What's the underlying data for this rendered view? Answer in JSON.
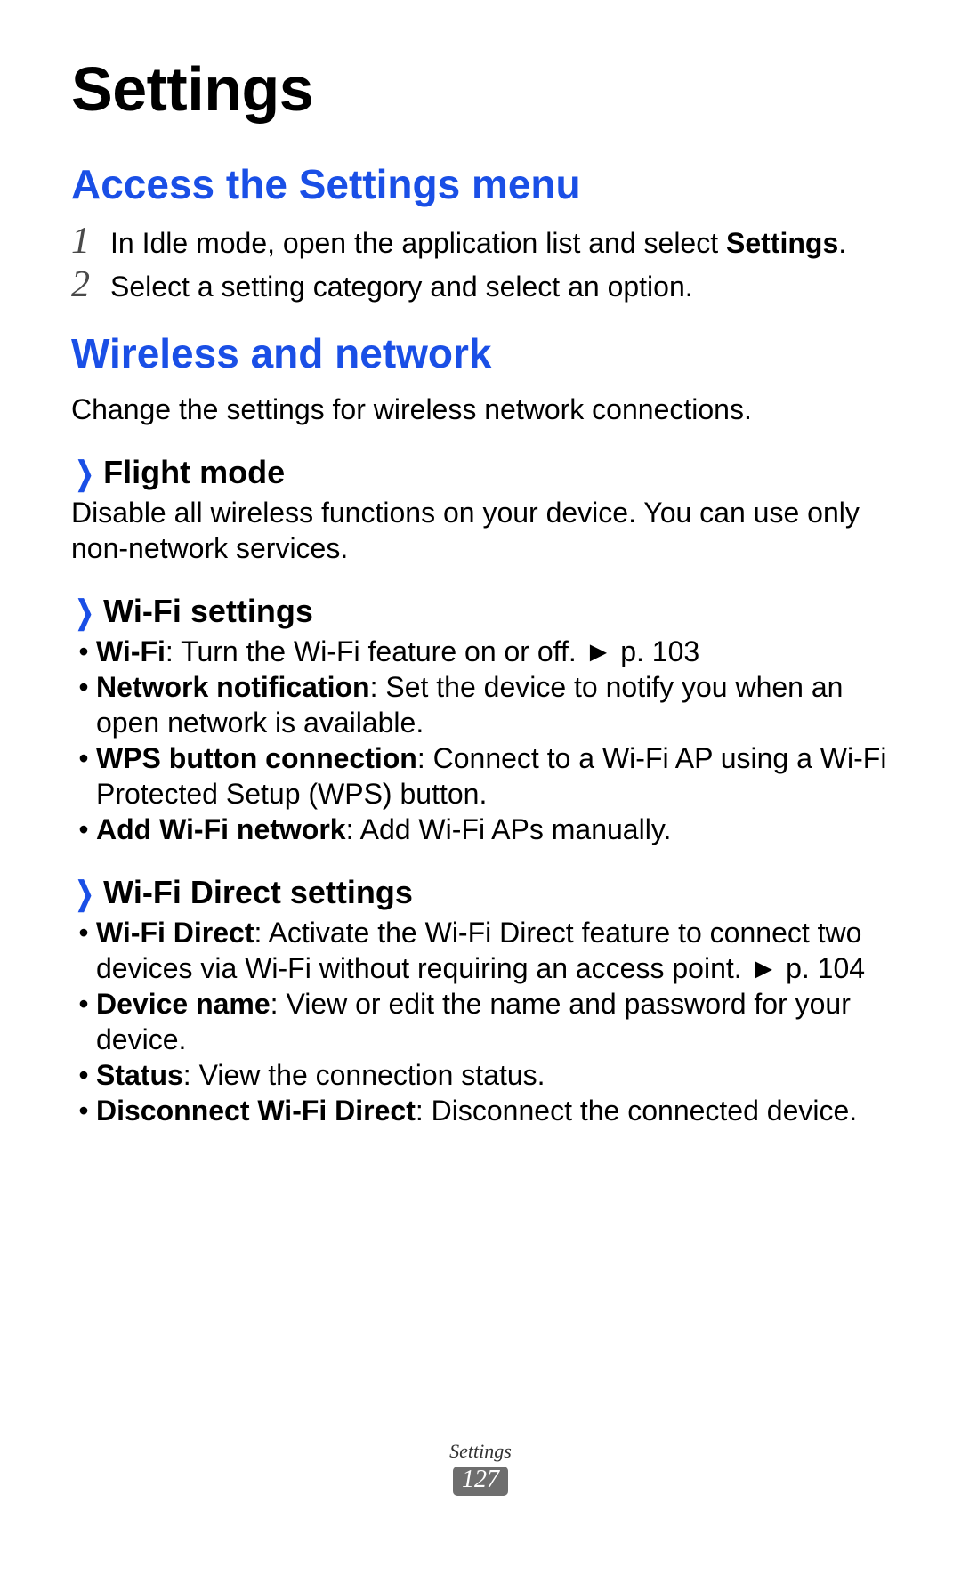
{
  "title": "Settings",
  "sections": {
    "access": {
      "heading": "Access the Settings menu",
      "steps": [
        {
          "num": "1",
          "pre": "In Idle mode, open the application list and select ",
          "bold": "Settings",
          "post": "."
        },
        {
          "num": "2",
          "pre": "Select a setting category and select an option.",
          "bold": "",
          "post": ""
        }
      ]
    },
    "wireless": {
      "heading": "Wireless and network",
      "desc": "Change the settings for wireless network connections.",
      "subs": [
        {
          "title": "Flight mode",
          "desc": "Disable all wireless functions on your device. You can use only non-network services.",
          "bullets": []
        },
        {
          "title": "Wi-Fi settings",
          "desc": "",
          "bullets": [
            {
              "bold": "Wi-Fi",
              "rest": ": Turn the Wi-Fi feature on or off. ► p. 103"
            },
            {
              "bold": "Network notification",
              "rest": ": Set the device to notify you when an open network is available."
            },
            {
              "bold": "WPS button connection",
              "rest": ": Connect to a Wi-Fi AP using a Wi-Fi Protected Setup (WPS) button."
            },
            {
              "bold": "Add Wi-Fi network",
              "rest": ": Add Wi-Fi APs manually."
            }
          ]
        },
        {
          "title": "Wi-Fi Direct settings",
          "desc": "",
          "bullets": [
            {
              "bold": "Wi-Fi Direct",
              "rest": ": Activate the Wi-Fi Direct feature to connect two devices via Wi-Fi without requiring an access point. ► p. 104"
            },
            {
              "bold": "Device name",
              "rest": ": View or edit the name and password for your device."
            },
            {
              "bold": "Status",
              "rest": ": View the connection status."
            },
            {
              "bold": "Disconnect Wi-Fi Direct",
              "rest": ": Disconnect the connected device."
            }
          ]
        }
      ]
    }
  },
  "footer": {
    "label": "Settings",
    "page": "127"
  }
}
